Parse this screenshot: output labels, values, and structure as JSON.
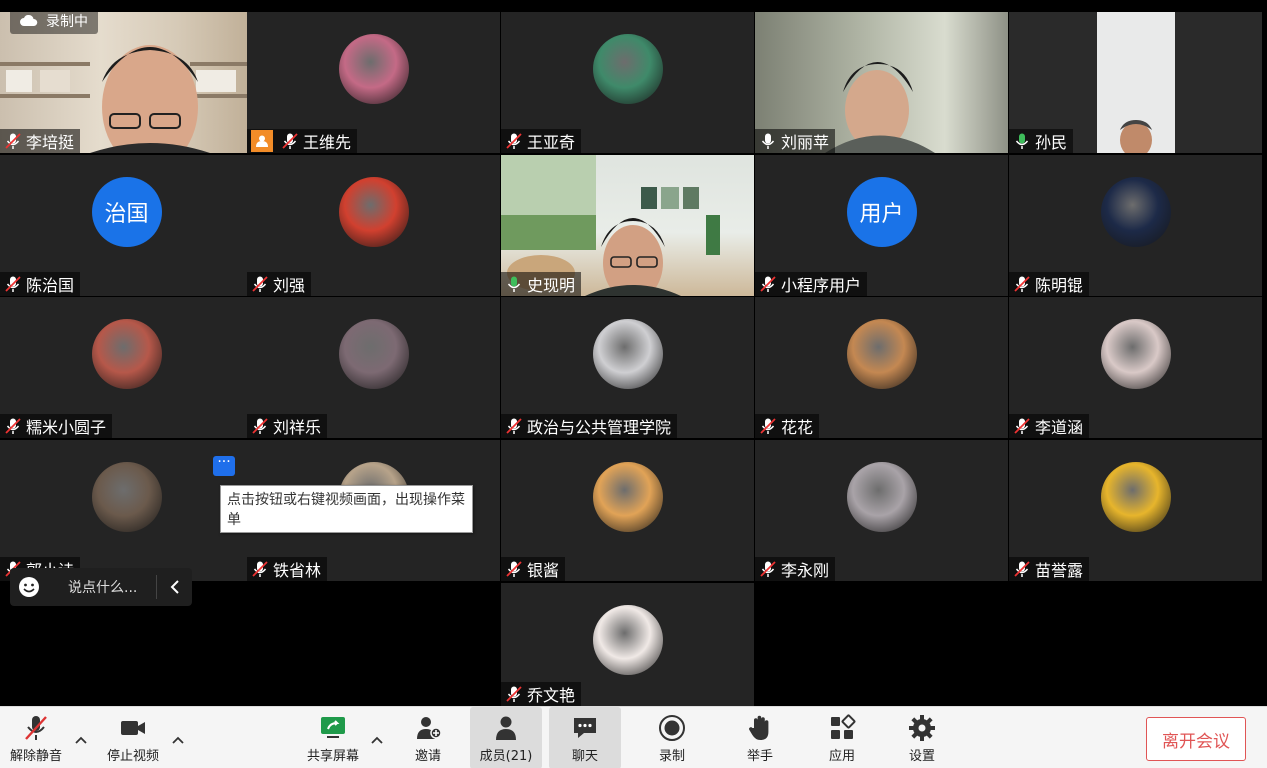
{
  "recording": {
    "label": "录制中"
  },
  "participants": [
    {
      "name": "李培挺",
      "muted": true,
      "kind": "video-bookshelf"
    },
    {
      "name": "王维先",
      "muted": true,
      "host": true,
      "kind": "avatar-img",
      "color": "#c46a86"
    },
    {
      "name": "王亚奇",
      "muted": true,
      "kind": "avatar-img",
      "color": "#3f8a6a"
    },
    {
      "name": "刘丽苹",
      "muted": false,
      "kind": "video-room"
    },
    {
      "name": "孙民",
      "muted": false,
      "speaking": true,
      "kind": "video-portrait"
    },
    {
      "name": "陈治国",
      "muted": true,
      "kind": "avatar-text",
      "avatar_text": "治国"
    },
    {
      "name": "刘强",
      "muted": true,
      "kind": "avatar-img",
      "color": "#d1402f"
    },
    {
      "name": "史现明",
      "muted": false,
      "speaking": true,
      "active": true,
      "kind": "video-livingroom"
    },
    {
      "name": "小程序用户",
      "muted": true,
      "kind": "avatar-text",
      "avatar_text": "用户"
    },
    {
      "name": "陈明锟",
      "muted": true,
      "kind": "avatar-img",
      "color": "#1d2a48"
    },
    {
      "name": "糯米小圆子",
      "muted": true,
      "kind": "avatar-img",
      "color": "#b6584a"
    },
    {
      "name": "刘祥乐",
      "muted": true,
      "kind": "avatar-img",
      "color": "#7d6a73"
    },
    {
      "name": "政治与公共管理学院",
      "muted": true,
      "kind": "avatar-img",
      "color": "#cfcfd2"
    },
    {
      "name": "花花",
      "muted": true,
      "kind": "avatar-img",
      "color": "#c48852"
    },
    {
      "name": "李道涵",
      "muted": true,
      "kind": "avatar-img",
      "color": "#d9c9c7"
    },
    {
      "name": "郭小诗",
      "muted": true,
      "kind": "avatar-img",
      "color": "#6b5a4c"
    },
    {
      "name": "铁省林",
      "muted": true,
      "kind": "avatar-img",
      "color": "#b7a38a"
    },
    {
      "name": "银酱",
      "muted": true,
      "kind": "avatar-img",
      "color": "#e1a357"
    },
    {
      "name": "李永刚",
      "muted": true,
      "kind": "avatar-img",
      "color": "#a9a3a8"
    },
    {
      "name": "苗誉露",
      "muted": true,
      "kind": "avatar-img",
      "color": "#e7b52c"
    },
    {
      "name": "乔文艳",
      "muted": true,
      "kind": "avatar-img",
      "color": "#f0e9e6"
    }
  ],
  "tooltip": {
    "text": "点击按钮或右键视频画面，出现操作菜单"
  },
  "chat": {
    "placeholder": "说点什么..."
  },
  "toolbar": {
    "unmute": "解除静音",
    "stop_video": "停止视频",
    "share": "共享屏幕",
    "invite": "邀请",
    "members": "成员(21)",
    "chat": "聊天",
    "record": "录制",
    "raise_hand": "举手",
    "apps": "应用",
    "settings": "设置",
    "leave": "离开会议"
  },
  "colors": {
    "accent": "#1a73e8",
    "active_border": "#3ebd5b",
    "leave": "#e05555",
    "share_green": "#1f9a4a"
  }
}
